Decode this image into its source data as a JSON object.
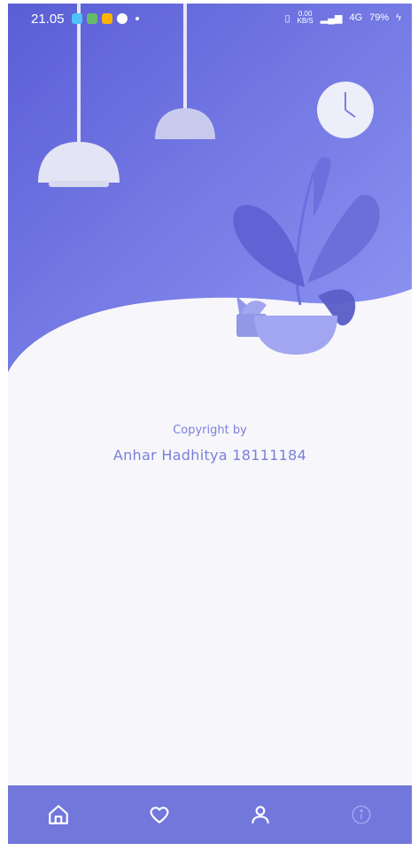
{
  "status_bar": {
    "time": "21.05",
    "network_speed": "0.00",
    "network_unit": "KB/S",
    "signal_type": "4G",
    "battery": "79%"
  },
  "content": {
    "copyright_label": "Copyright by",
    "author": "Anhar Hadhitya 18111184"
  },
  "bottom_nav": {
    "items": [
      "home-icon",
      "heart-icon",
      "person-icon",
      "info-icon"
    ]
  },
  "colors": {
    "primary": "#6e72dc",
    "hero_dark": "#5d61d6",
    "hero_light": "#8f93f2",
    "background": "#f7f7fb",
    "text": "#7b7fd9"
  }
}
